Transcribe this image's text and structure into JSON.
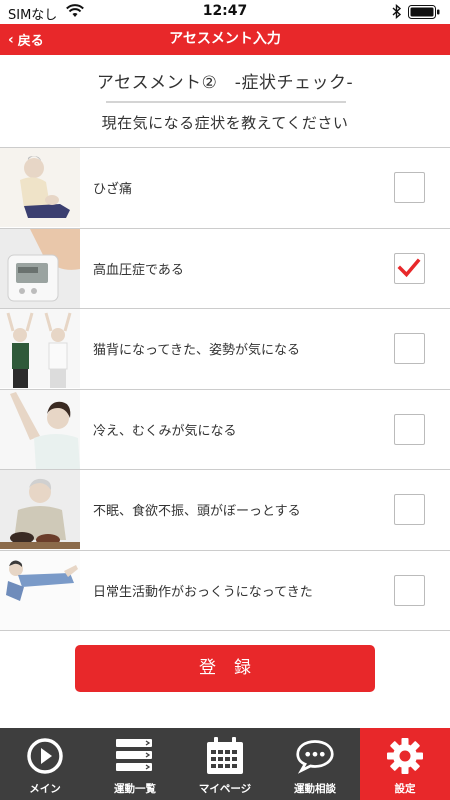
{
  "status": {
    "carrier": "SIMなし",
    "time": "12:47"
  },
  "nav": {
    "back_label": "戻る",
    "title": "アセスメント入力"
  },
  "header": {
    "title": "アセスメント②　-症状チェック-",
    "subtitle": "現在気になる症状を教えてください"
  },
  "symptoms": [
    {
      "label": "ひざ痛",
      "checked": false,
      "image": "knee-pain-photo"
    },
    {
      "label": "高血圧症である",
      "checked": true,
      "image": "blood-pressure-monitor-photo"
    },
    {
      "label": "猫背になってきた、姿勢が気になる",
      "checked": false,
      "image": "stretching-couple-photo"
    },
    {
      "label": "冷え、むくみが気になる",
      "checked": false,
      "image": "arm-stretch-photo"
    },
    {
      "label": "不眠、食欲不振、頭がぼーっとする",
      "checked": false,
      "image": "elderly-meal-photo"
    },
    {
      "label": "日常生活動作がおっくうになってきた",
      "checked": false,
      "image": "lying-man-photo"
    }
  ],
  "register_label": "登録",
  "tabs": [
    {
      "label": "メイン",
      "icon": "play-icon"
    },
    {
      "label": "運動一覧",
      "icon": "list-icon"
    },
    {
      "label": "マイページ",
      "icon": "calendar-icon"
    },
    {
      "label": "運動相談",
      "icon": "chat-icon"
    },
    {
      "label": "設定",
      "icon": "gear-icon",
      "active": true
    }
  ],
  "colors": {
    "accent": "#e8282a",
    "tabbar": "#3e3e3e"
  }
}
